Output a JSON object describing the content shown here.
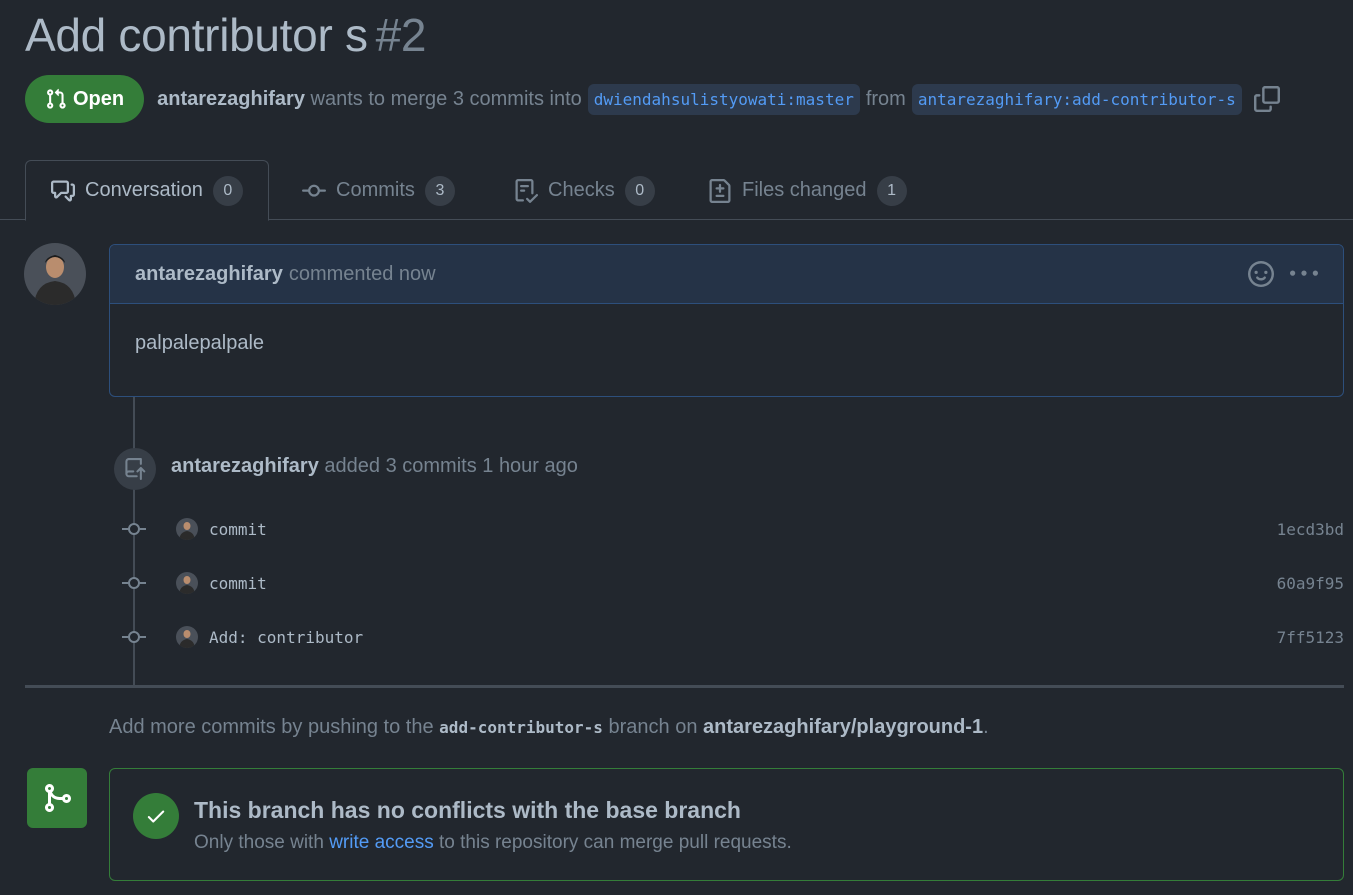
{
  "pr": {
    "title": "Add contributor s",
    "number": "#2",
    "state": "Open",
    "author": "antarezaghifary",
    "merge_text": "wants to merge 3 commits into",
    "base_branch": "dwiendahsulistyowati:master",
    "from_text": "from",
    "head_branch": "antarezaghifary:add-contributor-s"
  },
  "tabs": [
    {
      "label": "Conversation",
      "count": "0",
      "icon": "comment-discussion-icon"
    },
    {
      "label": "Commits",
      "count": "3",
      "icon": "git-commit-icon"
    },
    {
      "label": "Checks",
      "count": "0",
      "icon": "checklist-icon"
    },
    {
      "label": "Files changed",
      "count": "1",
      "icon": "file-diff-icon"
    }
  ],
  "comment": {
    "author": "antarezaghifary",
    "meta": "commented now",
    "body": "palpalepalpale"
  },
  "push_event": {
    "author": "antarezaghifary",
    "text": "added 3 commits 1 hour ago"
  },
  "commits": [
    {
      "message": "commit",
      "sha": "1ecd3bd"
    },
    {
      "message": "commit",
      "sha": "60a9f95"
    },
    {
      "message": "Add: contributor",
      "sha": "7ff5123"
    }
  ],
  "hint": {
    "prefix": "Add more commits by pushing to the",
    "branch": "add-contributor-s",
    "middle": "branch on",
    "repo": "antarezaghifary/playground-1",
    "suffix": "."
  },
  "merge": {
    "title": "This branch has no conflicts with the base branch",
    "sub_prefix": "Only those with",
    "sub_link": "write access",
    "sub_suffix": "to this repository can merge pull requests."
  },
  "colors": {
    "background": "#22272e",
    "success": "#347d39",
    "accent": "#539bf5"
  }
}
